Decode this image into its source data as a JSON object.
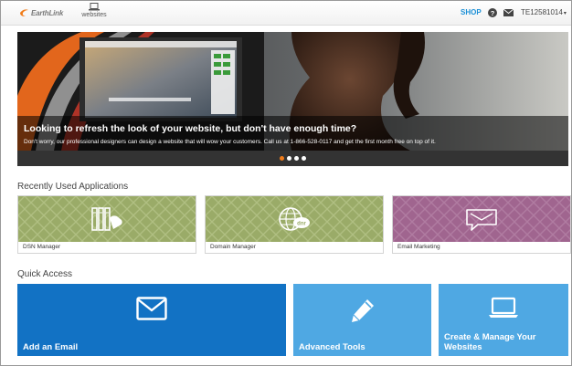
{
  "header": {
    "logo_text": "EarthLink",
    "websites_label": "websites",
    "shop_label": "SHOP",
    "account_id": "TE12581014",
    "caret": "▾"
  },
  "hero": {
    "title": "Looking to refresh the look of your website, but don't have enough time?",
    "description": "Don't worry, our professional designers can design a website that will wow your customers. Call us at 1-866-528-0117 and get the first month free on top of it.",
    "dots": 4,
    "active_dot": 0
  },
  "recent_apps": {
    "title": "Recently Used Applications",
    "items": [
      {
        "label": "DSN Manager",
        "icon": "servers-icon",
        "color": "#9aab68"
      },
      {
        "label": "Domain Manager",
        "icon": "globe-dnr-icon",
        "color": "#9aab68"
      },
      {
        "label": "Email Marketing",
        "icon": "chat-bubble-icon",
        "color": "#a0658f"
      }
    ]
  },
  "quick_access": {
    "title": "Quick Access",
    "items": [
      {
        "label": "Add an Email",
        "icon": "envelope-icon",
        "color": "#1272c4"
      },
      {
        "label": "Advanced Tools",
        "icon": "pencil-icon",
        "color": "#4fa8e3"
      },
      {
        "label": "Create & Manage Your Websites",
        "icon": "laptop-icon",
        "color": "#4fa8e3"
      }
    ]
  },
  "colors": {
    "accent": "#1a8fd6",
    "carousel_active": "#f07c1a"
  }
}
